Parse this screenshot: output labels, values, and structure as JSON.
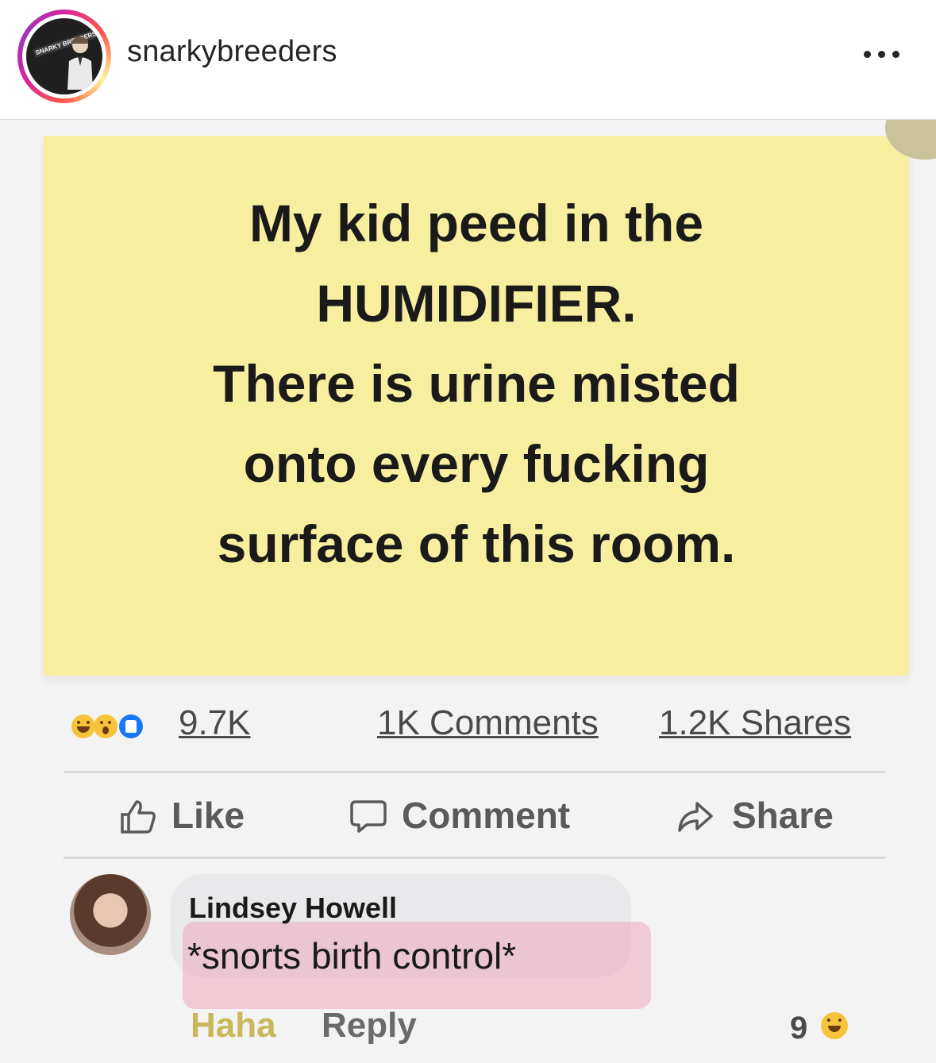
{
  "header": {
    "username": "snarkybreeders",
    "avatar_badge": "SNARKY BREEDERS",
    "more_icon": "ellipsis-icon"
  },
  "post": {
    "text_lines": [
      "My kid peed in the",
      "HUMIDIFIER.",
      "There is urine misted",
      "onto every fucking",
      "surface of this room."
    ],
    "background_color": "#f7ef9f",
    "reactions": {
      "icons": [
        "haha-reaction-icon",
        "wow-reaction-icon",
        "like-reaction-icon"
      ],
      "count": "9.7K"
    },
    "comments_count": "1K Comments",
    "shares_count": "1.2K Shares",
    "actions": {
      "like": "Like",
      "comment": "Comment",
      "share": "Share"
    }
  },
  "comment": {
    "author": "Lindsey Howell",
    "text": "*snorts birth control*",
    "haha_label": "Haha",
    "reply_label": "Reply",
    "reaction_count": "9",
    "reaction_icon": "haha-reaction-icon"
  }
}
